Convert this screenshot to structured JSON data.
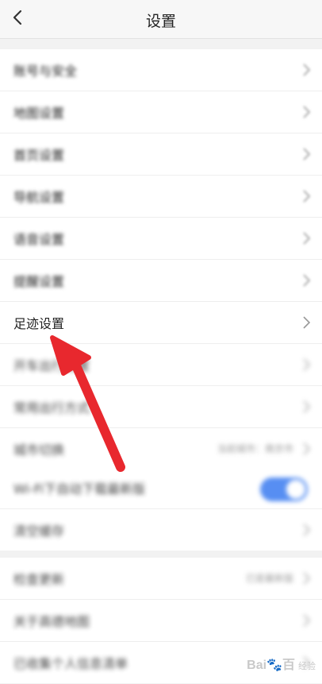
{
  "header": {
    "title": "设置",
    "back_icon": "chevron-left-icon"
  },
  "group1": [
    {
      "label": "账号与安全"
    },
    {
      "label": "地图设置"
    },
    {
      "label": "首页设置"
    },
    {
      "label": "导航设置"
    },
    {
      "label": "语音设置"
    },
    {
      "label": "提醒设置"
    },
    {
      "label": "足迹设置"
    },
    {
      "label": "开车出行设置"
    },
    {
      "label": "常用出行方式"
    },
    {
      "label": "城市切换",
      "value": "当前城市：南京市"
    }
  ],
  "group2": [
    {
      "label": "Wi-Fi下自动下载最新版",
      "toggle_on": true
    },
    {
      "label": "清空缓存"
    }
  ],
  "group3": [
    {
      "label": "检查更新",
      "value": "已是最新版"
    },
    {
      "label": "关于高德地图"
    },
    {
      "label": "已收集个人信息清单"
    }
  ],
  "annotation": {
    "arrow_color": "#e8282e"
  },
  "watermark": {
    "brand": "Bai🐾百",
    "sub": "经验"
  },
  "colors": {
    "accent": "#3a7bf0",
    "background": "#f2f2f2"
  }
}
